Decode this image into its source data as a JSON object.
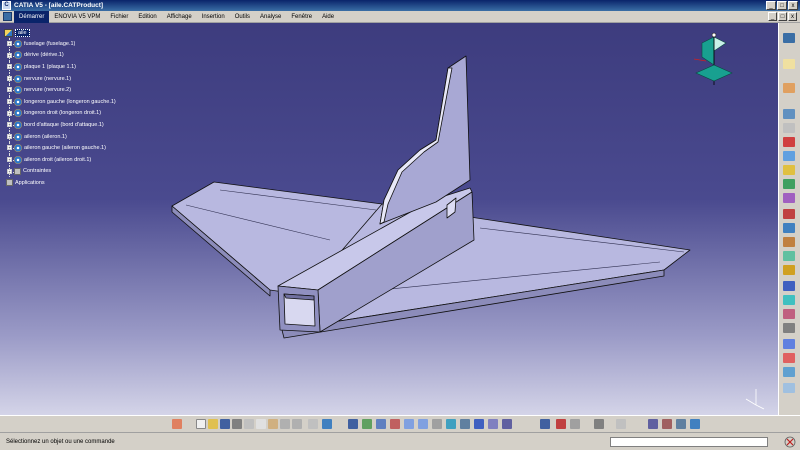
{
  "window": {
    "title": "CATIA V5 - [aile.CATProduct]",
    "min": "_",
    "max": "□",
    "close": "x"
  },
  "menu": {
    "items": [
      "Démarrer",
      "ENOVIA V5 VPM",
      "Fichier",
      "Edition",
      "Affichage",
      "Insertion",
      "Outils",
      "Analyse",
      "Fenêtre",
      "Aide"
    ],
    "active_index": 0
  },
  "tree": {
    "root": "aile",
    "items": [
      "fuselage (fuselage.1)",
      "dérive (dérive.1)",
      "plaque 1 (plaque 1.1)",
      "nervure (nervure.1)",
      "nervure (nervure.2)",
      "longeron gauche (longeron gauche.1)",
      "longeron droit (longeron droit.1)",
      "bord d'attaque (bord d'attaque.1)",
      "aileron (aileron.1)",
      "aileron gauche (aileron gauche.1)",
      "aileron droit (aileron droit.1)",
      "Contraintes"
    ],
    "tail": "Applications"
  },
  "status": {
    "message": "Sélectionnez un objet ou une commande",
    "command_placeholder": ""
  },
  "colors": {
    "bg_top": "#3d3c7e",
    "bg_bottom": "#d4d4e8",
    "part_face": "#b4b4dc",
    "part_light": "#c8c8ea",
    "part_dark": "#8a8ab8",
    "edge": "#101010",
    "compass": "#18a090"
  },
  "icons": {
    "compass": "compass-icon",
    "axis": "axis-triad-icon",
    "product": "product-icon",
    "part": "part-icon"
  }
}
